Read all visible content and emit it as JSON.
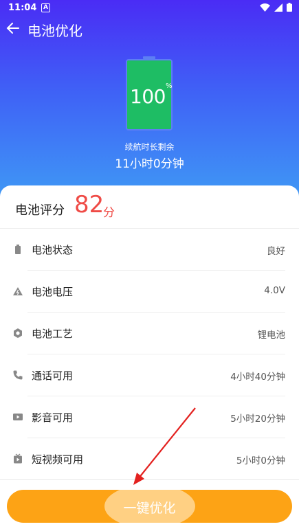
{
  "status_bar": {
    "time": "11:04",
    "indicator": "A",
    "icons": [
      "wifi-icon",
      "signal-icon",
      "battery-icon"
    ]
  },
  "app_bar": {
    "title": "电池优化",
    "back_icon": "back-arrow-icon"
  },
  "battery": {
    "percent_text": "100",
    "unit": "%",
    "level": 1.0,
    "color": "#1ebd64"
  },
  "remaining": {
    "label": "续航时长剩余",
    "value": "11小时0分钟"
  },
  "score": {
    "label": "电池评分",
    "value": "82",
    "unit": "分",
    "color": "#ef4b46"
  },
  "items": [
    {
      "icon": "battery-status-icon",
      "label": "电池状态",
      "value": "良好"
    },
    {
      "icon": "voltage-icon",
      "label": "电池电压",
      "value": "4.0V"
    },
    {
      "icon": "process-icon",
      "label": "电池工艺",
      "value": "锂电池"
    },
    {
      "icon": "phone-icon",
      "label": "通话可用",
      "value": "4小时40分钟"
    },
    {
      "icon": "video-icon",
      "label": "影音可用",
      "value": "5小时20分钟"
    },
    {
      "icon": "short-video-icon",
      "label": "短视频可用",
      "value": "5小时0分钟"
    }
  ],
  "action": {
    "label": "一键优化",
    "color": "#fda315"
  },
  "colors": {
    "hero_top": "#4a2cf5",
    "hero_bottom": "#3f9cf5",
    "accent": "#fda315"
  }
}
